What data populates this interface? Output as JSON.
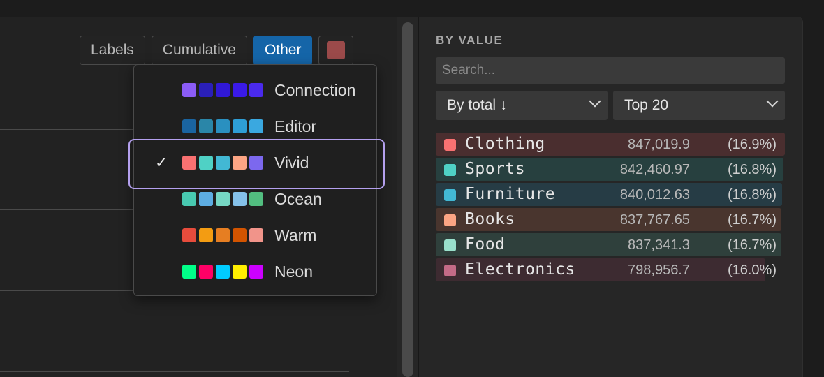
{
  "toolbar": {
    "labels_label": "Labels",
    "cumulative_label": "Cumulative",
    "other_label": "Other",
    "swatch_color": "#9b4a4a"
  },
  "palette_menu": {
    "options": [
      {
        "name": "Connection",
        "selected": false,
        "colors": [
          "#8b5cf6",
          "#2a1fb8",
          "#3018d6",
          "#3a1ae8",
          "#4a2aee"
        ]
      },
      {
        "name": "Editor",
        "selected": false,
        "colors": [
          "#1a64a0",
          "#2a86a8",
          "#2a90c0",
          "#2e9ed6",
          "#3aa8e0"
        ]
      },
      {
        "name": "Vivid",
        "selected": true,
        "colors": [
          "#f87171",
          "#4fd1c5",
          "#42b8d4",
          "#fca584",
          "#7c68ee"
        ]
      },
      {
        "name": "Ocean",
        "selected": false,
        "colors": [
          "#48c9b0",
          "#5dade2",
          "#76d7c4",
          "#85c1e9",
          "#52be80"
        ]
      },
      {
        "name": "Warm",
        "selected": false,
        "colors": [
          "#e74c3c",
          "#f39c12",
          "#e67e22",
          "#d35400",
          "#f1948a"
        ]
      },
      {
        "name": "Neon",
        "selected": false,
        "colors": [
          "#00ff88",
          "#ff0066",
          "#00ccff",
          "#ffee00",
          "#cc00ff"
        ]
      }
    ],
    "check_glyph": "✓"
  },
  "right_panel": {
    "title": "BY VALUE",
    "search_placeholder": "Search...",
    "sort_select": "By total ↓",
    "limit_select": "Top 20",
    "rows": [
      {
        "label": "Clothing",
        "value": "847,019.9",
        "pct": "(16.9%)",
        "color": "#f87171",
        "bg": "#4a2e2f",
        "fraction": 1.0
      },
      {
        "label": "Sports",
        "value": "842,460.97",
        "pct": "(16.8%)",
        "color": "#4fd1c5",
        "bg": "#27403f",
        "fraction": 0.995
      },
      {
        "label": "Furniture",
        "value": "840,012.63",
        "pct": "(16.8%)",
        "color": "#42b8d4",
        "bg": "#263c45",
        "fraction": 0.992
      },
      {
        "label": "Books",
        "value": "837,767.65",
        "pct": "(16.7%)",
        "color": "#fca584",
        "bg": "#49352e",
        "fraction": 0.989
      },
      {
        "label": "Food",
        "value": "837,341.3",
        "pct": "(16.7%)",
        "color": "#99e0cc",
        "bg": "#2f403c",
        "fraction": 0.989
      },
      {
        "label": "Electronics",
        "value": "798,956.7",
        "pct": "(16.0%)",
        "color": "#c46b87",
        "bg": "#3d2b31",
        "fraction": 0.943
      }
    ]
  }
}
